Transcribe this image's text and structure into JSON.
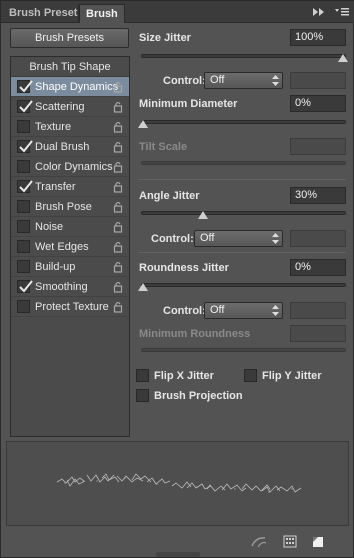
{
  "tabs": [
    {
      "label": "Brush Presets",
      "active": false
    },
    {
      "label": "Brush",
      "active": true
    }
  ],
  "header_icons": [
    "collapse-icon",
    "panel-menu-icon"
  ],
  "brush_presets_button": "Brush Presets",
  "list": {
    "header": "Brush Tip Shape",
    "items": [
      {
        "label": "Shape Dynamics",
        "checked": true,
        "selected": true
      },
      {
        "label": "Scattering",
        "checked": true,
        "selected": false
      },
      {
        "label": "Texture",
        "checked": false,
        "selected": false
      },
      {
        "label": "Dual Brush",
        "checked": true,
        "selected": false
      },
      {
        "label": "Color Dynamics",
        "checked": false,
        "selected": false
      },
      {
        "label": "Transfer",
        "checked": true,
        "selected": false
      },
      {
        "label": "Brush Pose",
        "checked": false,
        "selected": false
      },
      {
        "label": "Noise",
        "checked": false,
        "selected": false
      },
      {
        "label": "Wet Edges",
        "checked": false,
        "selected": false
      },
      {
        "label": "Build-up",
        "checked": false,
        "selected": false
      },
      {
        "label": "Smoothing",
        "checked": true,
        "selected": false
      },
      {
        "label": "Protect Texture",
        "checked": false,
        "selected": false
      }
    ]
  },
  "settings": {
    "size_jitter": {
      "label": "Size Jitter",
      "value": "100%",
      "level": 1.0
    },
    "size_control": {
      "label": "Control:",
      "value": "Off"
    },
    "min_diameter": {
      "label": "Minimum Diameter",
      "value": "0%",
      "level": 0.0
    },
    "tilt_scale": {
      "label": "Tilt Scale"
    },
    "angle_jitter": {
      "label": "Angle Jitter",
      "value": "30%",
      "level": 0.3
    },
    "angle_control": {
      "label": "Control:",
      "value": "Off"
    },
    "roundness_jitter": {
      "label": "Roundness Jitter",
      "value": "0%",
      "level": 0.0
    },
    "roundness_control": {
      "label": "Control:",
      "value": "Off"
    },
    "min_roundness": {
      "label": "Minimum Roundness"
    },
    "flip_x": {
      "label": "Flip X Jitter",
      "checked": false
    },
    "flip_y": {
      "label": "Flip Y Jitter",
      "checked": false
    },
    "brush_projection": {
      "label": "Brush Projection",
      "checked": false
    }
  },
  "bottom_icons": [
    "toggle-live-tip-preview-icon",
    "open-preset-manager-icon",
    "create-new-brush-icon"
  ],
  "colors": {
    "panel_bg": "#535353",
    "selected_row": "#7a8c9e",
    "field_bg": "#3a3a3a"
  }
}
